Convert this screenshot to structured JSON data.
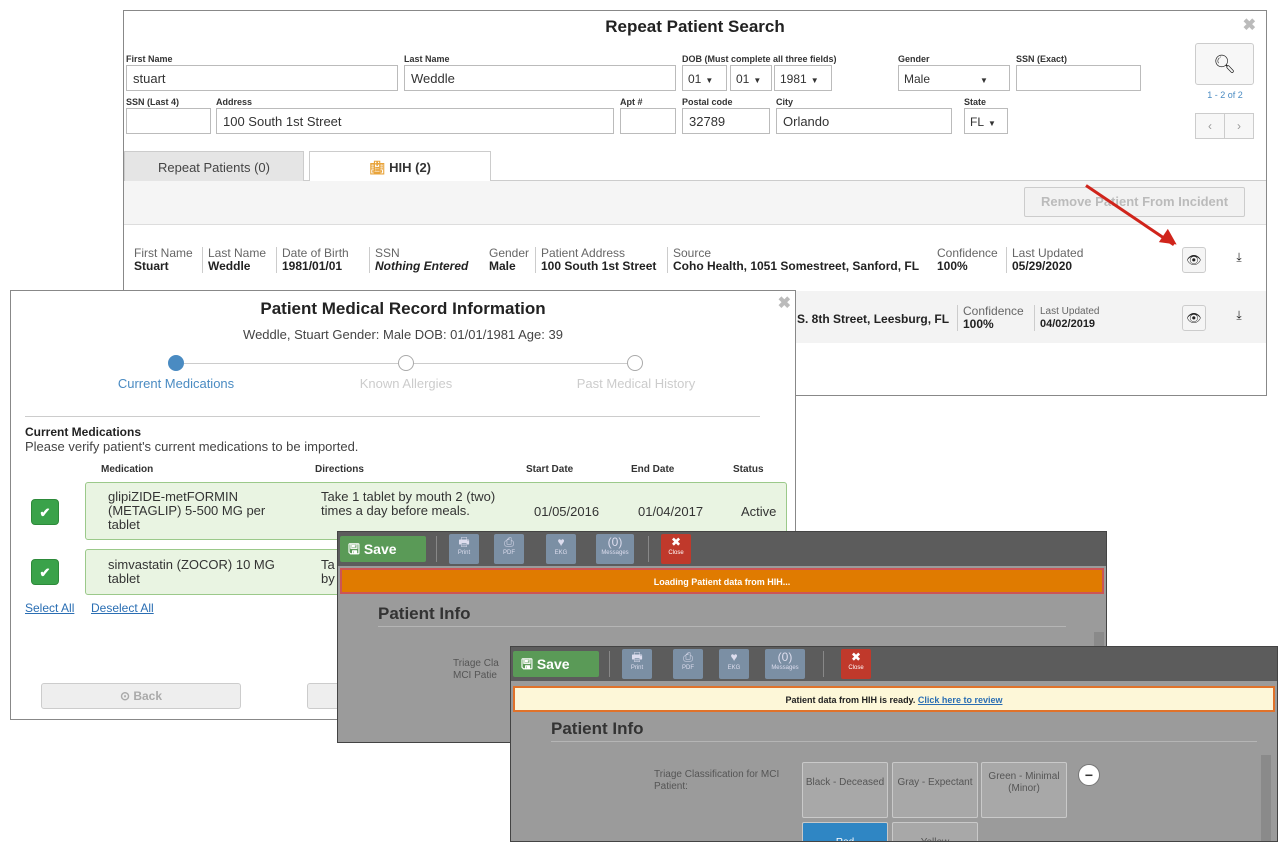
{
  "search": {
    "title": "Repeat Patient Search",
    "close": "✖",
    "fields": {
      "first_name_label": "First Name",
      "first_name": "stuart",
      "last_name_label": "Last Name",
      "last_name": "Weddle",
      "dob_label": "DOB (Must complete all three fields)",
      "dob_month": "01",
      "dob_day": "01",
      "dob_year": "1981",
      "gender_label": "Gender",
      "gender": "Male",
      "ssn_exact_label": "SSN (Exact)",
      "ssn_exact": "",
      "ssn_last4_label": "SSN (Last 4)",
      "ssn_last4": "",
      "address_label": "Address",
      "address": "100 South 1st Street",
      "apt_label": "Apt #",
      "apt": "",
      "postal_label": "Postal code",
      "postal": "32789",
      "city_label": "City",
      "city": "Orlando",
      "state_label": "State",
      "state": "FL"
    },
    "search_icon": "search-icon",
    "pagination": "1 - 2 of 2",
    "prev": "‹",
    "next": "›",
    "tabs": [
      {
        "label": "Repeat Patients (0)"
      },
      {
        "label": "HIH (2)"
      }
    ],
    "remove_button": "Remove Patient From Incident",
    "results": [
      {
        "first_name_h": "First Name",
        "first_name": "Stuart",
        "last_name_h": "Last Name",
        "last_name": "Weddle",
        "dob_h": "Date of Birth",
        "dob": "1981/01/01",
        "ssn_h": "SSN",
        "ssn": "Nothing Entered",
        "gender_h": "Gender",
        "gender": "Male",
        "addr_h": "Patient Address",
        "addr": "100 South 1st Street",
        "source_h": "Source",
        "source": "Coho Health, 1051 Somestreet, Sanford, FL",
        "conf_h": "Confidence",
        "conf": "100%",
        "upd_h": "Last Updated",
        "upd": "05/29/2020"
      },
      {
        "source": "S. 8th Street, Leesburg, FL",
        "conf_h": "Confidence",
        "conf": "100%",
        "upd_h": "Last Updated",
        "upd": "04/02/2019"
      }
    ]
  },
  "medrec": {
    "title": "Patient Medical Record Information",
    "subtitle": "Weddle, Stuart  Gender: Male  DOB: 01/01/1981  Age: 39",
    "close": "✖",
    "steps": [
      "Current Medications",
      "Known Allergies",
      "Past Medical History"
    ],
    "section_title": "Current Medications",
    "instructions": "Please verify patient's current medications to be imported.",
    "columns": [
      "Medication",
      "Directions",
      "Start Date",
      "End Date",
      "Status"
    ],
    "meds": [
      {
        "name": "glipiZIDE-metFORMIN (METAGLIP) 5-500 MG per tablet",
        "directions": "Take 1 tablet by mouth 2 (two) times a day before meals.",
        "start": "01/05/2016",
        "end": "01/04/2017",
        "status": "Active"
      },
      {
        "name": "simvastatin (ZOCOR) 10 MG tablet",
        "directions": "Ta by",
        "start": "",
        "end": "",
        "status": ""
      }
    ],
    "select_all": "Select All",
    "deselect_all": "Deselect All",
    "back": "⊙ Back"
  },
  "app1": {
    "save": "Save",
    "toolbar": [
      {
        "icon": "🖶",
        "label": "Print"
      },
      {
        "icon": "⎙",
        "label": "PDF"
      },
      {
        "icon": "♥",
        "label": "EKG"
      },
      {
        "icon": "(0)",
        "label": "Messages"
      }
    ],
    "close_icon": "✖",
    "close_label": "Close",
    "banner": "Loading Patient data from HIH...",
    "section": "Patient Info",
    "triage_label": "Triage Cla MCI Patie"
  },
  "app2": {
    "save": "Save",
    "toolbar": [
      {
        "icon": "🖶",
        "label": "Print"
      },
      {
        "icon": "⎙",
        "label": "PDF"
      },
      {
        "icon": "♥",
        "label": "EKG"
      },
      {
        "icon": "(0)",
        "label": "Messages"
      }
    ],
    "close_icon": "✖",
    "close_label": "Close",
    "banner_text": "Patient data from HIH is ready.",
    "banner_link": "Click here to review",
    "section": "Patient Info",
    "triage_label": "Triage Classification for MCI Patient:",
    "triage_options": [
      "Black - Deceased",
      "Gray - Expectant",
      "Green - Minimal (Minor)",
      "Red",
      "Yellow"
    ]
  },
  "colors": {
    "accent": "#4a8bc2",
    "green": "#3aa24a",
    "orange": "#e07b00",
    "red_arrow": "#d0241b"
  }
}
